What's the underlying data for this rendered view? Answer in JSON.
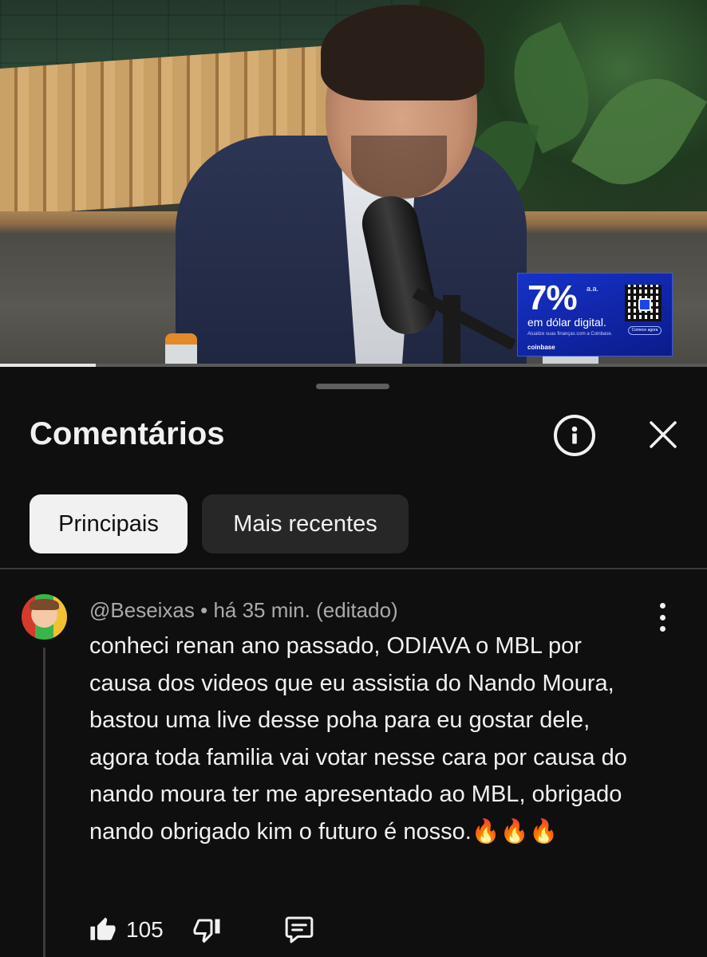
{
  "video": {
    "ad": {
      "headline": "7%",
      "rate_suffix": "a.a.",
      "tagline": "em dólar digital.",
      "subline": "Atualize suas finanças com a Coinbase.",
      "brand": "coinbase",
      "cta": "Comece agora"
    },
    "progress_fraction": 0.135
  },
  "sheet": {
    "title": "Comentários",
    "icons": {
      "info": "info-icon",
      "close": "close-icon"
    },
    "chips": [
      {
        "label": "Principais",
        "active": true
      },
      {
        "label": "Mais recentes",
        "active": false
      }
    ]
  },
  "comment": {
    "meta": "@Beseixas • há 35 min. (editado)",
    "text": "conheci renan ano passado, ODIAVA o MBL por causa dos videos que eu assistia do Nando Moura, bastou uma live desse poha para eu gostar dele, agora toda familia vai votar nesse cara por causa do nando moura ter me apresentado ao MBL, obrigado nando obrigado kim o futuro é nosso.🔥🔥🔥",
    "likes": "105",
    "icons": {
      "more": "more-vert-icon",
      "like": "thumbs-up-icon",
      "dislike": "thumbs-down-icon",
      "reply": "reply-icon"
    }
  },
  "colors": {
    "background": "#0f0f0f",
    "text": "#f1f1f1",
    "secondary_text": "#aaaaaa",
    "chip_active_bg": "#f1f1f1",
    "chip_inactive_bg": "#272727",
    "ad_blue": "#1632c9"
  }
}
